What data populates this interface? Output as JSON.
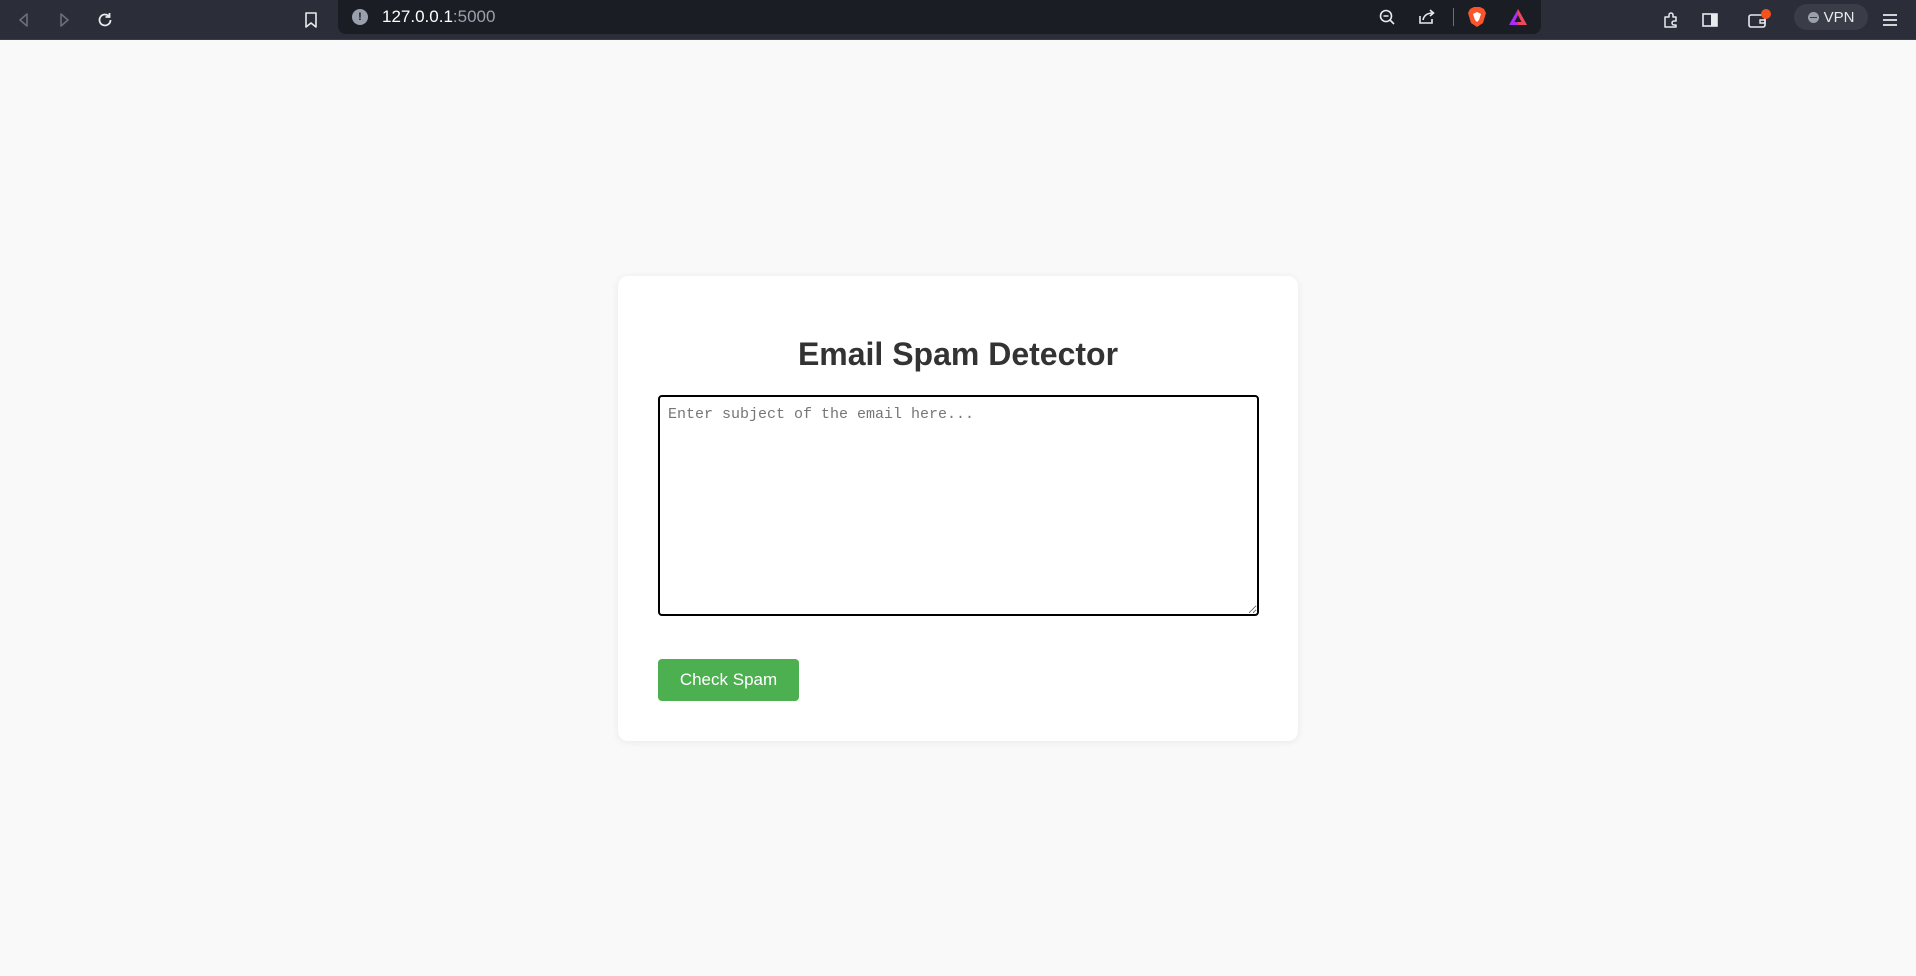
{
  "browser": {
    "url_host": "127.0.0.1",
    "url_port": ":5000",
    "vpn_label": "VPN",
    "icons": [
      "back-icon",
      "forward-icon",
      "reload-icon",
      "bookmark-icon",
      "site-info-icon",
      "zoom-out-icon",
      "share-icon",
      "brave-shields-icon",
      "brave-rewards-icon",
      "extensions-icon",
      "sidebar-icon",
      "wallet-icon",
      "menu-icon"
    ],
    "wallet_badge_color": "#f4511e"
  },
  "page": {
    "title": "Email Spam Detector",
    "email_input": {
      "placeholder": "Enter subject of the email here...",
      "value": ""
    },
    "check_button_label": "Check Spam",
    "button_color": "#4caf50"
  }
}
